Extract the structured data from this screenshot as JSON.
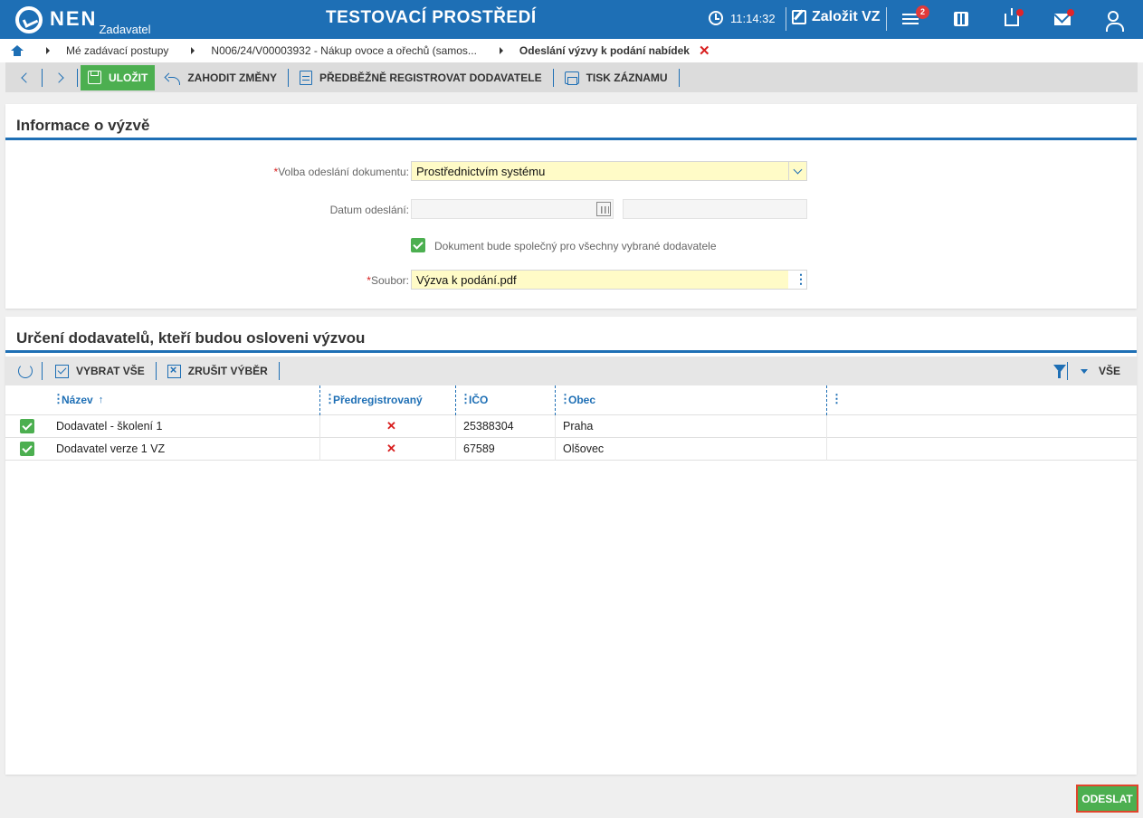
{
  "header": {
    "logo_text": "NEN",
    "logo_sub": "Zadavatel",
    "env_title": "TESTOVACÍ PROSTŘEDÍ",
    "time": "11:14:32",
    "create_label": "Založit VZ",
    "menu_badge": "2",
    "icons": [
      "clock-icon",
      "edit-icon",
      "menu-icon",
      "calculator-icon",
      "inbox-icon",
      "mail-icon",
      "user-icon"
    ]
  },
  "breadcrumb": {
    "items": [
      "Mé zadávací postupy",
      "N006/24/V00003932 - Nákup ovoce a ořechů (samos...",
      "Odeslání výzvy k podání nabídek"
    ]
  },
  "toolbar": {
    "save_label": "ULOŽIT",
    "discard_label": "ZAHODIT ZMĚNY",
    "preregister_label": "PŘEDBĚŽNĚ REGISTROVAT DODAVATELE",
    "print_label": "TISK ZÁZNAMU"
  },
  "info_panel": {
    "title": "Informace o výzvě",
    "send_option": {
      "label": "Volba odeslání dokumentu:",
      "value": "Prostřednictvím systému"
    },
    "send_date": {
      "label": "Datum odeslání:",
      "value": "",
      "time_value": ""
    },
    "common_doc": {
      "label": "Dokument bude společný pro všechny vybrané dodavatele",
      "checked": true
    },
    "file": {
      "label": "Soubor:",
      "value": "Výzva k podání.pdf"
    }
  },
  "suppliers_panel": {
    "title": "Určení dodavatelů, kteří budou osloveni výzvou",
    "select_all_label": "VYBRAT VŠE",
    "clear_selection_label": "ZRUŠIT VÝBĚR",
    "view_label": "VŠE",
    "columns": [
      "Název",
      "Předregistrovaný",
      "IČO",
      "Obec"
    ],
    "rows": [
      {
        "checked": true,
        "name": "Dodavatel - školení 1",
        "preregistered": "✕",
        "ico": "25388304",
        "city": "Praha"
      },
      {
        "checked": true,
        "name": "Dodavatel verze 1 VZ",
        "preregistered": "✕",
        "ico": "67589",
        "city": "Olšovec"
      }
    ]
  },
  "footer": {
    "send_label": "ODESLAT"
  },
  "colors": {
    "primary": "#1e6fb5",
    "success": "#4caf50",
    "danger": "#d81e1e",
    "required_bg": "#fffbc7"
  }
}
